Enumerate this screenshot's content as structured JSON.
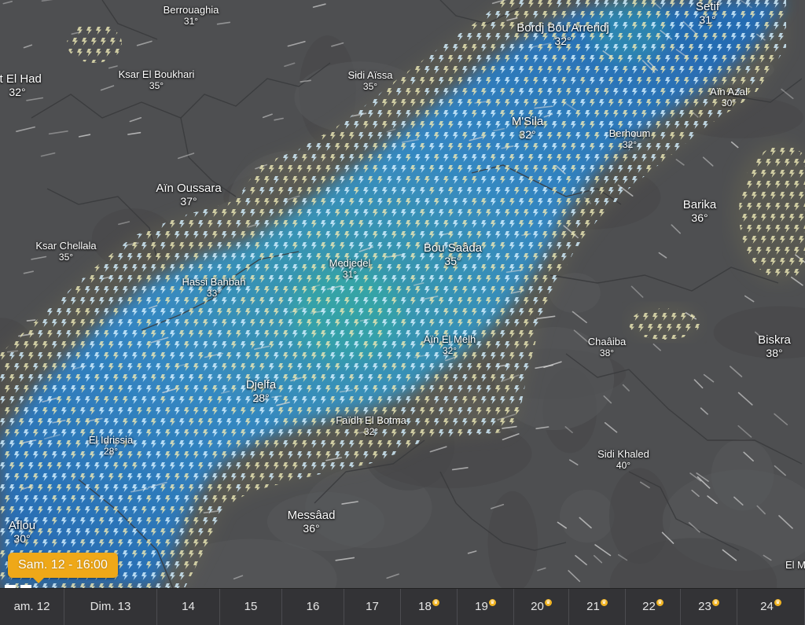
{
  "layer": {
    "name": "thunderstorm",
    "colors": {
      "storm_core": "#2f8fd6",
      "storm_edge": "#1c6cc0",
      "storm_center": "#29b3a8",
      "glyph_pale": "#eae6b4",
      "glyph_core": "#d4f0ff",
      "base_map": "#4e4f51",
      "accent": "#efa818"
    }
  },
  "cities": [
    {
      "name": "Berrouaghia",
      "temp": "31°",
      "size": "sm"
    },
    {
      "name": "Bordj Bou Arreridj",
      "temp": "32°",
      "size": "lg"
    },
    {
      "name": "Setif",
      "temp": "31°",
      "size": "lg"
    },
    {
      "name": "et El Had",
      "temp": "32°",
      "size": "lg"
    },
    {
      "name": "Ksar El Boukhari",
      "temp": "35°",
      "size": "sm"
    },
    {
      "name": "Sidi Aïssa",
      "temp": "35°",
      "size": "sm"
    },
    {
      "name": "Aïn Azal",
      "temp": "30°",
      "size": "sm"
    },
    {
      "name": "M'Sila",
      "temp": "32°",
      "size": "lg"
    },
    {
      "name": "Berhoum",
      "temp": "32°",
      "size": "sm"
    },
    {
      "name": "Aïn Oussara",
      "temp": "37°",
      "size": "lg"
    },
    {
      "name": "Barika",
      "temp": "36°",
      "size": "lg"
    },
    {
      "name": "Ksar Chellala",
      "temp": "35°",
      "size": "sm"
    },
    {
      "name": "Bou Saâda",
      "temp": "35°",
      "size": "lg"
    },
    {
      "name": "Medjedel",
      "temp": "31°",
      "size": "sm"
    },
    {
      "name": "Hassi Bahbah",
      "temp": "33°",
      "size": "sm"
    },
    {
      "name": "Aïn El Melh",
      "temp": "32°",
      "size": "sm"
    },
    {
      "name": "Chaâiba",
      "temp": "38°",
      "size": "sm"
    },
    {
      "name": "Biskra",
      "temp": "38°",
      "size": "lg"
    },
    {
      "name": "Djelfa",
      "temp": "28°",
      "size": "lg"
    },
    {
      "name": "Faïdh El Botma",
      "temp": "32°",
      "size": "sm"
    },
    {
      "name": "El Idrissia",
      "temp": "28°",
      "size": "sm"
    },
    {
      "name": "Sidi Khaled",
      "temp": "40°",
      "size": "sm"
    },
    {
      "name": "Messâad",
      "temp": "36°",
      "size": "lg"
    },
    {
      "name": "Aflou",
      "temp": "30°",
      "size": "lg"
    },
    {
      "name": "El M",
      "temp": "",
      "size": "sm"
    }
  ],
  "tooltip": {
    "text": "Sam. 12 - 16:00"
  },
  "timeline": {
    "days": [
      {
        "label": "am. 12",
        "icon": false
      },
      {
        "label": "Dim. 13",
        "icon": false
      },
      {
        "label": "14",
        "icon": false
      },
      {
        "label": "15",
        "icon": false
      },
      {
        "label": "16",
        "icon": false
      },
      {
        "label": "17",
        "icon": false
      },
      {
        "label": "18",
        "icon": true
      },
      {
        "label": "19",
        "icon": true
      },
      {
        "label": "20",
        "icon": true
      },
      {
        "label": "21",
        "icon": true
      },
      {
        "label": "22",
        "icon": true
      },
      {
        "label": "23",
        "icon": true
      },
      {
        "label": "24",
        "icon": true
      }
    ],
    "premium_icon_name": "premium-crown-icon"
  }
}
